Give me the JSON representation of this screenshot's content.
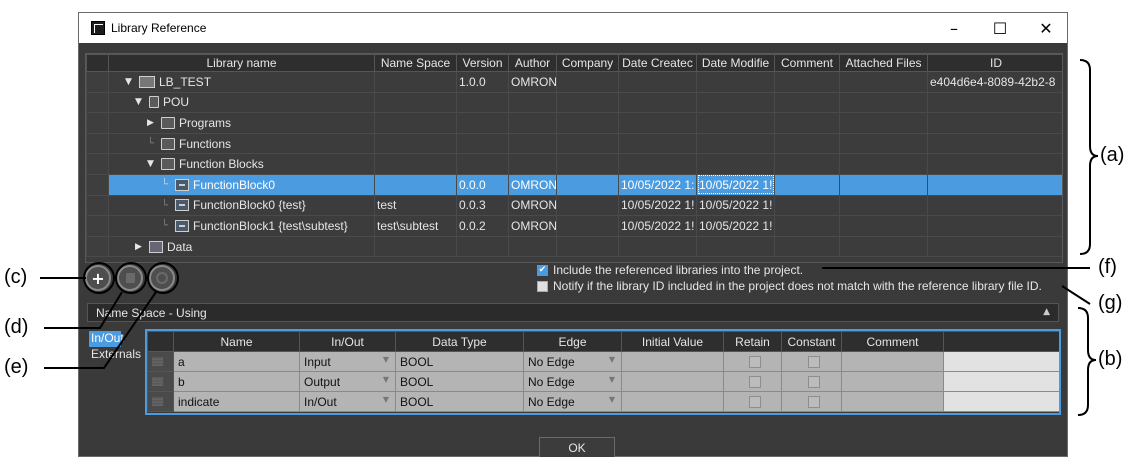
{
  "window": {
    "title": "Library Reference",
    "minimize": "–",
    "maximize": "☐",
    "close": "✕"
  },
  "library_table": {
    "columns": [
      "Library name",
      "Name Space",
      "Version",
      "Author",
      "Company",
      "Date Createc",
      "Date Modifie",
      "Comment",
      "Attached Files",
      "ID"
    ],
    "rows": [
      {
        "name": "LB_TEST",
        "namespace": "",
        "version": "1.0.0",
        "author": "OMRON",
        "company": "",
        "created": "",
        "modified": "",
        "comment": "",
        "files": "",
        "id": "e404d6e4-8089-42b2-8"
      },
      {
        "name": "POU",
        "namespace": "",
        "version": "",
        "author": "",
        "company": "",
        "created": "",
        "modified": "",
        "comment": "",
        "files": "",
        "id": ""
      },
      {
        "name": "Programs",
        "namespace": "",
        "version": "",
        "author": "",
        "company": "",
        "created": "",
        "modified": "",
        "comment": "",
        "files": "",
        "id": ""
      },
      {
        "name": "Functions",
        "namespace": "",
        "version": "",
        "author": "",
        "company": "",
        "created": "",
        "modified": "",
        "comment": "",
        "files": "",
        "id": ""
      },
      {
        "name": "Function Blocks",
        "namespace": "",
        "version": "",
        "author": "",
        "company": "",
        "created": "",
        "modified": "",
        "comment": "",
        "files": "",
        "id": ""
      },
      {
        "name": "FunctionBlock0",
        "namespace": "",
        "version": "0.0.0",
        "author": "OMRON",
        "company": "",
        "created": "10/05/2022 1:",
        "modified": "10/05/2022 1!",
        "comment": "",
        "files": "",
        "id": ""
      },
      {
        "name": "FunctionBlock0 {test}",
        "namespace": "test",
        "version": "0.0.3",
        "author": "OMRON",
        "company": "",
        "created": "10/05/2022 1!",
        "modified": "10/05/2022 1!",
        "comment": "",
        "files": "",
        "id": ""
      },
      {
        "name": "FunctionBlock1 {test\\subtest}",
        "namespace": "test\\subtest",
        "version": "0.0.2",
        "author": "OMRON",
        "company": "",
        "created": "10/05/2022 1!",
        "modified": "10/05/2022 1!",
        "comment": "",
        "files": "",
        "id": ""
      },
      {
        "name": "Data",
        "namespace": "",
        "version": "",
        "author": "",
        "company": "",
        "created": "",
        "modified": "",
        "comment": "",
        "files": "",
        "id": ""
      }
    ]
  },
  "buttons": {
    "add": "+",
    "ok": "OK"
  },
  "options": {
    "include_label": "Include the referenced libraries into the project.",
    "include_checked": true,
    "notify_label": "Notify if the library ID included in the project does not match with the reference library file ID.",
    "notify_checked": false
  },
  "namespace_bar": {
    "label": "Name Space - Using"
  },
  "side_tabs": [
    "In/Out",
    "Externals"
  ],
  "variable_table": {
    "columns": [
      "Name",
      "In/Out",
      "Data Type",
      "Edge",
      "Initial Value",
      "Retain",
      "Constant",
      "Comment"
    ],
    "rows": [
      {
        "name": "a",
        "inout": "Input",
        "type": "BOOL",
        "edge": "No Edge",
        "initial": "",
        "comment": ""
      },
      {
        "name": "b",
        "inout": "Output",
        "type": "BOOL",
        "edge": "No Edge",
        "initial": "",
        "comment": ""
      },
      {
        "name": "indicate",
        "inout": "In/Out",
        "type": "BOOL",
        "edge": "No Edge",
        "initial": "",
        "comment": ""
      }
    ]
  },
  "callouts": {
    "a": "(a)",
    "b": "(b)",
    "c": "(c)",
    "d": "(d)",
    "e": "(e)",
    "f": "(f)",
    "g": "(g)"
  },
  "colors": {
    "selection": "#4a9be0",
    "window_bg": "#3a3a3a",
    "cell_bg": "#b4b4b4"
  }
}
